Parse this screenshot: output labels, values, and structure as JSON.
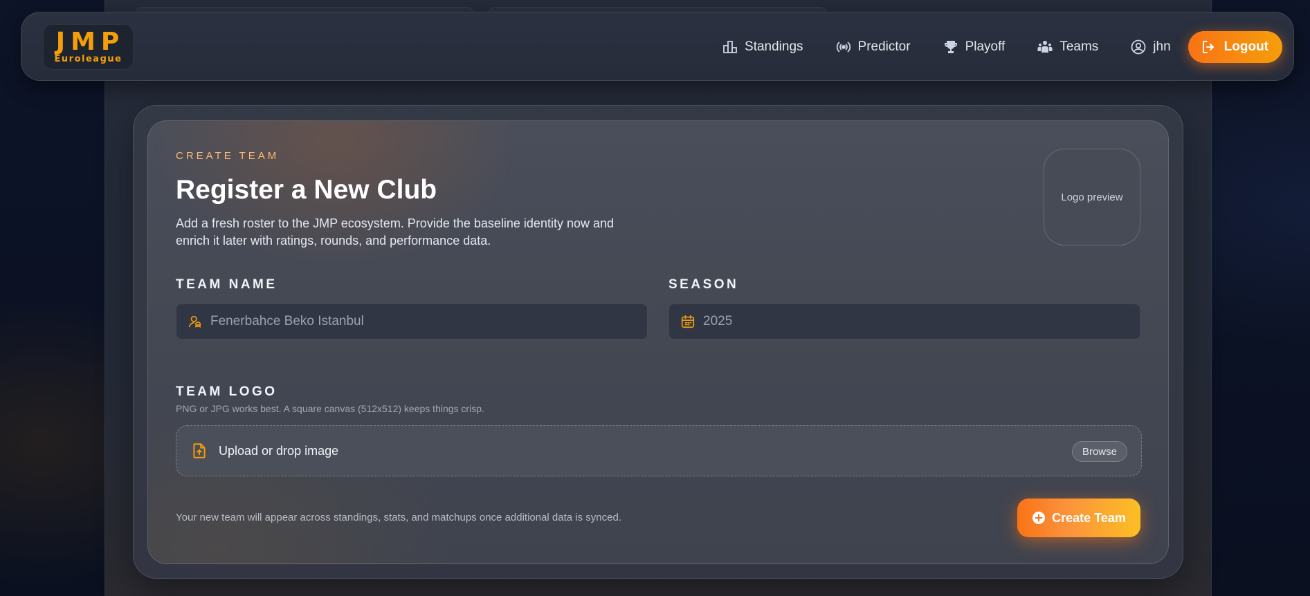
{
  "brand": {
    "logo_main": "JMP",
    "logo_sub": "Euroleague",
    "accent": "#f59e0b",
    "accent_gradient_start": "#f97316"
  },
  "nav": {
    "items": [
      {
        "label": "Standings",
        "icon": "podium-icon"
      },
      {
        "label": "Predictor",
        "icon": "broadcast-icon"
      },
      {
        "label": "Playoff",
        "icon": "trophy-icon"
      },
      {
        "label": "Teams",
        "icon": "users-icon"
      }
    ],
    "user": {
      "label": "jhn",
      "icon": "user-circle-icon"
    },
    "logout_label": "Logout"
  },
  "form": {
    "eyebrow": "CREATE TEAM",
    "title": "Register a New Club",
    "subtitle": "Add a fresh roster to the JMP ecosystem. Provide the baseline identity now and enrich it later with ratings, rounds, and performance data.",
    "logo_preview": "Logo preview",
    "team_name": {
      "label": "TEAM NAME",
      "placeholder": "Fenerbahce Beko Istanbul",
      "value": ""
    },
    "season": {
      "label": "SEASON",
      "placeholder": "2025",
      "value": ""
    },
    "team_logo": {
      "label": "TEAM LOGO",
      "hint": "PNG or JPG works best. A square canvas (512x512) keeps things crisp.",
      "dropzone_text": "Upload or drop image",
      "browse_label": "Browse"
    },
    "footer_note": "Your new team will appear across standings, stats, and matchups once additional data is synced.",
    "submit_label": "Create Team"
  }
}
